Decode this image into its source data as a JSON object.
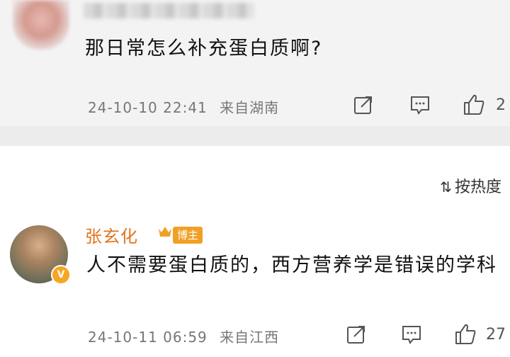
{
  "comments": [
    {
      "text": "那日常怎么补充蛋白质啊?",
      "timestamp": "24-10-10 22:41",
      "location": "来自湖南",
      "like_count": "2",
      "icons": [
        "share-icon",
        "comment-icon",
        "like-icon"
      ]
    },
    {
      "author": "张玄化",
      "badge": "博主",
      "text": "人不需要蛋白质的，西方营养学是错误的学科",
      "timestamp": "24-10-11 06:59",
      "location": "来自江西",
      "like_count": "27",
      "icons": [
        "share-icon",
        "comment-icon",
        "like-icon"
      ]
    }
  ],
  "sort_label": "按热度"
}
